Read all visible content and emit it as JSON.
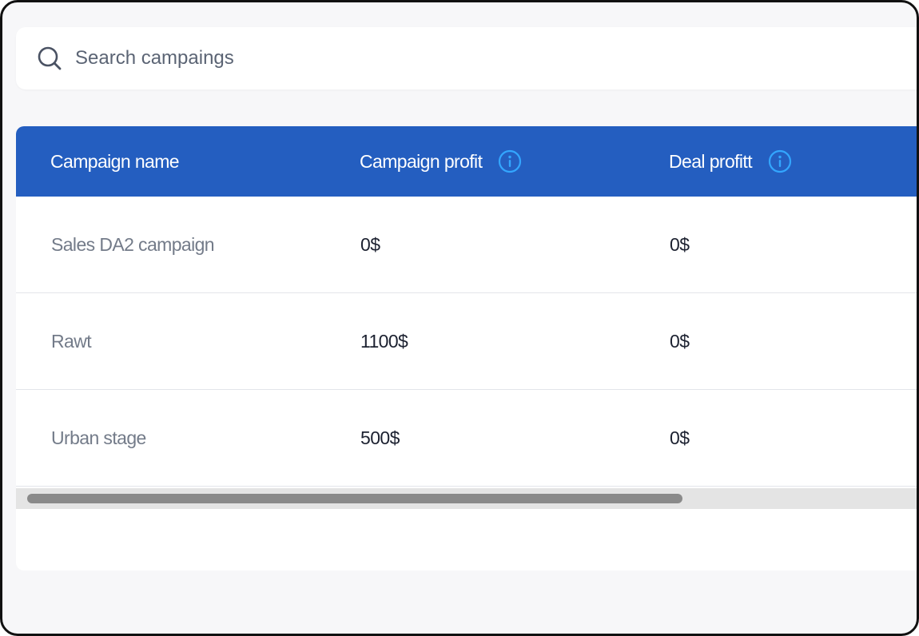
{
  "search": {
    "placeholder": "Search campaings",
    "icon": "search-icon"
  },
  "table": {
    "header_color": "#245ec0",
    "columns": [
      {
        "label": "Campaign name",
        "info_icon": false
      },
      {
        "label": "Campaign profit",
        "info_icon": true
      },
      {
        "label": "Deal profitt",
        "info_icon": true
      }
    ],
    "rows": [
      {
        "name": "Sales DA2 campaign",
        "campaign_profit": "0$",
        "deal_profit": "0$"
      },
      {
        "name": "Rawt",
        "campaign_profit": "1100$",
        "deal_profit": "0$"
      },
      {
        "name": "Urban stage",
        "campaign_profit": "500$",
        "deal_profit": "0$"
      }
    ]
  }
}
